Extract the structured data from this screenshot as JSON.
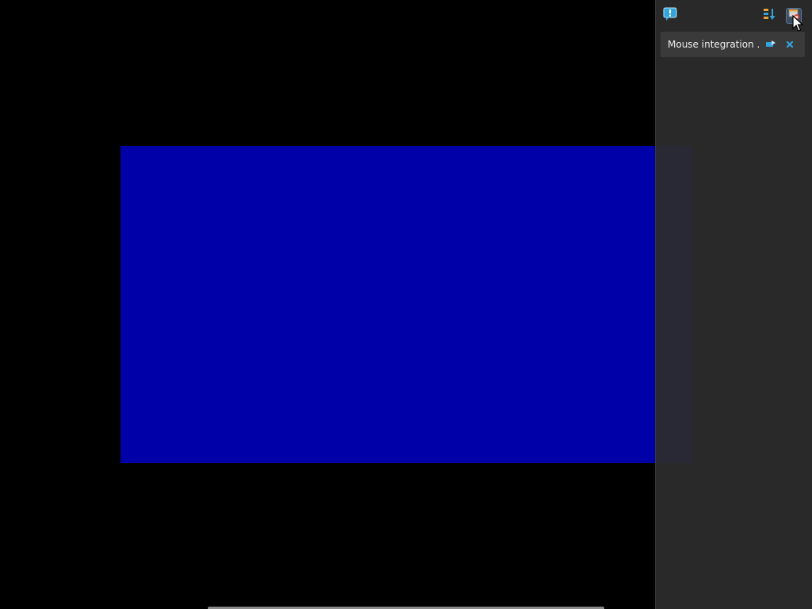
{
  "vm_display": {
    "background_color": "#0000a8"
  },
  "notification_panel": {
    "background_color": "#2c2c2c",
    "toolbar": {
      "help_icon": "help-balloon-icon",
      "sort_icon": "sort-icon",
      "close_all_icon": "close-all-icon"
    },
    "notifications": [
      {
        "text": "Mouse integration ...",
        "toggle_icon": "mouse-integration-icon",
        "dismiss_icon": "close-icon"
      }
    ]
  },
  "colors": {
    "accent": "#33a3dc",
    "toolbar_orange": "#e8a33c"
  }
}
